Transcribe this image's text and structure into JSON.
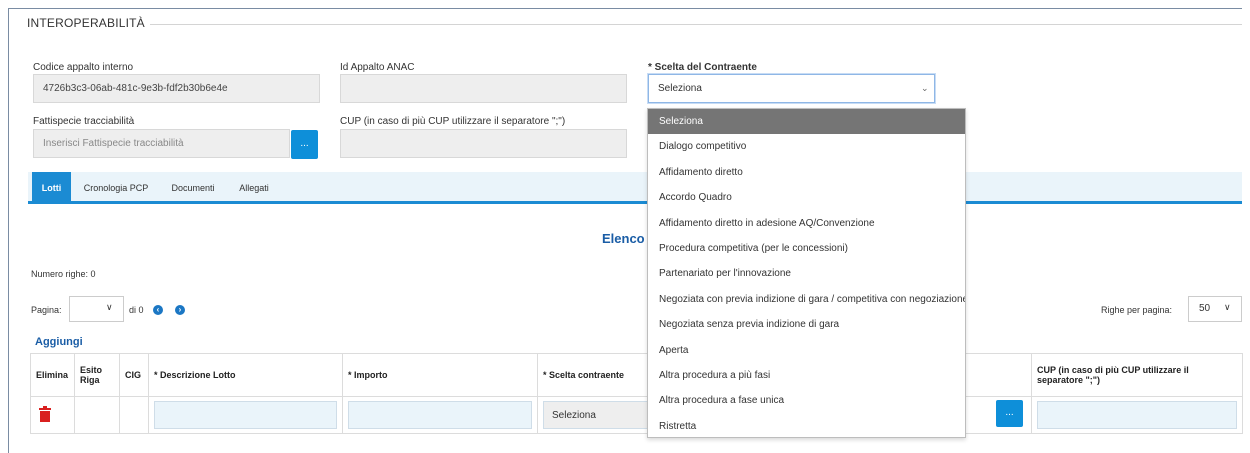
{
  "section": {
    "title": "INTEROPERABILITÀ"
  },
  "form": {
    "codice_label": "Codice appalto interno",
    "codice_value": "4726b3c3-06ab-481c-9e3b-fdf2b30b6e4e",
    "anac_label": "Id Appalto ANAC",
    "anac_value": "",
    "scelta_label": "* Scelta del Contraente",
    "scelta_value": "Seleziona",
    "fattispecie_label": "Fattispecie tracciabilità",
    "fattispecie_placeholder": "Inserisci Fattispecie tracciabilità",
    "fattispecie_button": "...",
    "cup_label": "CUP (in caso di più CUP utilizzare il separatore \";\")",
    "cup_value": ""
  },
  "tabs": [
    {
      "label": "Lotti",
      "active": true
    },
    {
      "label": "Cronologia PCP",
      "active": false
    },
    {
      "label": "Documenti",
      "active": false
    },
    {
      "label": "Allegati",
      "active": false
    }
  ],
  "main": {
    "elenco_title": "Elenco L",
    "numero_righe": "Numero righe: 0",
    "pagina_label": "Pagina:",
    "pagina_value": "",
    "di_label": "di 0",
    "righe_per_pagina_label": "Righe per pagina:",
    "righe_per_pagina_value": "50",
    "aggiungi": "Aggiungi"
  },
  "table": {
    "headers": {
      "elimina": "Elimina",
      "esito": "Esito Riga",
      "cig": "CIG",
      "descrizione": "* Descrizione Lotto",
      "importo": "* Importo",
      "scelta": "* Scelta contraente",
      "cup": "CUP (in caso di più CUP utilizzare il separatore \";\")"
    },
    "row": {
      "scelta_value": "Seleziona",
      "cup_button": "..."
    }
  },
  "dropdown": {
    "options": [
      "Seleziona",
      "Dialogo competitivo",
      "Affidamento diretto",
      "Accordo Quadro",
      "Affidamento diretto in adesione AQ/Convenzione",
      "Procedura competitiva (per le concessioni)",
      "Partenariato per l'innovazione",
      "Negoziata con previa indizione di gara / competitiva con negoziazione",
      "Negoziata senza previa indizione di gara",
      "Aperta",
      "Altra procedura a più fasi",
      "Altra procedura a fase unica",
      "Ristretta"
    ],
    "selected_index": 0
  },
  "colors": {
    "accent": "#1b8bd3",
    "delete": "#d9201f",
    "selected_option": "#757575",
    "title_blue": "#1a5da6"
  }
}
